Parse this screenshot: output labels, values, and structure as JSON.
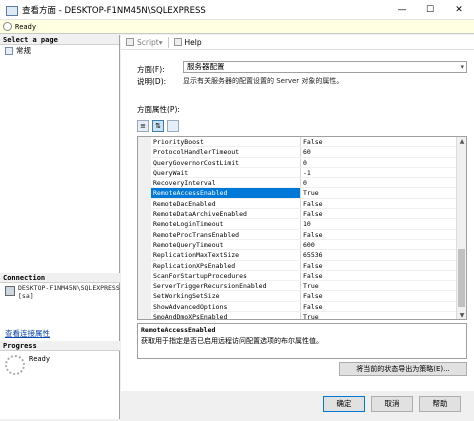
{
  "window": {
    "title": "查看方面 - DESKTOP-F1NM45N\\SQLEXPRESS",
    "minimize": "—",
    "maximize": "☐",
    "close": "✕"
  },
  "status": {
    "text": "Ready"
  },
  "sidebar": {
    "select_page_label": "Select a page",
    "items": [
      {
        "label": "常规"
      }
    ],
    "connection_label": "Connection",
    "server_lines": [
      "DESKTOP-F1NM45N\\SQLEXPRESS",
      "[sa]"
    ],
    "view_connection_link": "查看连接属性",
    "progress_label": "Progress",
    "progress_status": "Ready"
  },
  "toolbar": {
    "script_label": "Script",
    "help_label": "Help"
  },
  "form": {
    "facet_label": "方面(F):",
    "facet_value": "服务器配置",
    "description_label": "说明(D):",
    "description_text": "显示有关服务器的配置设置的 Server 对象的属性。",
    "properties_label": "方面属性(P):"
  },
  "properties": [
    {
      "name": "PriorityBoost",
      "value": "False"
    },
    {
      "name": "ProtocolHandlerTimeout",
      "value": "60"
    },
    {
      "name": "QueryGovernorCostLimit",
      "value": "0"
    },
    {
      "name": "QueryWait",
      "value": "-1"
    },
    {
      "name": "RecoveryInterval",
      "value": "0"
    },
    {
      "name": "RemoteAccessEnabled",
      "value": "True"
    },
    {
      "name": "RemoteDacEnabled",
      "value": "False"
    },
    {
      "name": "RemoteDataArchiveEnabled",
      "value": "False"
    },
    {
      "name": "RemoteLoginTimeout",
      "value": "10"
    },
    {
      "name": "RemoteProcTransEnabled",
      "value": "False"
    },
    {
      "name": "RemoteQueryTimeout",
      "value": "600"
    },
    {
      "name": "ReplicationMaxTextSize",
      "value": "65536"
    },
    {
      "name": "ReplicationXPsEnabled",
      "value": "False"
    },
    {
      "name": "ScanForStartupProcedures",
      "value": "False"
    },
    {
      "name": "ServerTriggerRecursionEnabled",
      "value": "True"
    },
    {
      "name": "SetWorkingSetSize",
      "value": "False"
    },
    {
      "name": "ShowAdvancedOptions",
      "value": "False"
    },
    {
      "name": "SmoAndDmoXPsEnabled",
      "value": "True"
    }
  ],
  "selected_property": {
    "name": "RemoteAccessEnabled",
    "description": "获取用于指定是否已启用远程访问配置选项的布尔属性值。"
  },
  "buttons": {
    "export": "将当前的状态导出为策略(E)...",
    "ok": "确定",
    "cancel": "取消",
    "help": "帮助"
  }
}
